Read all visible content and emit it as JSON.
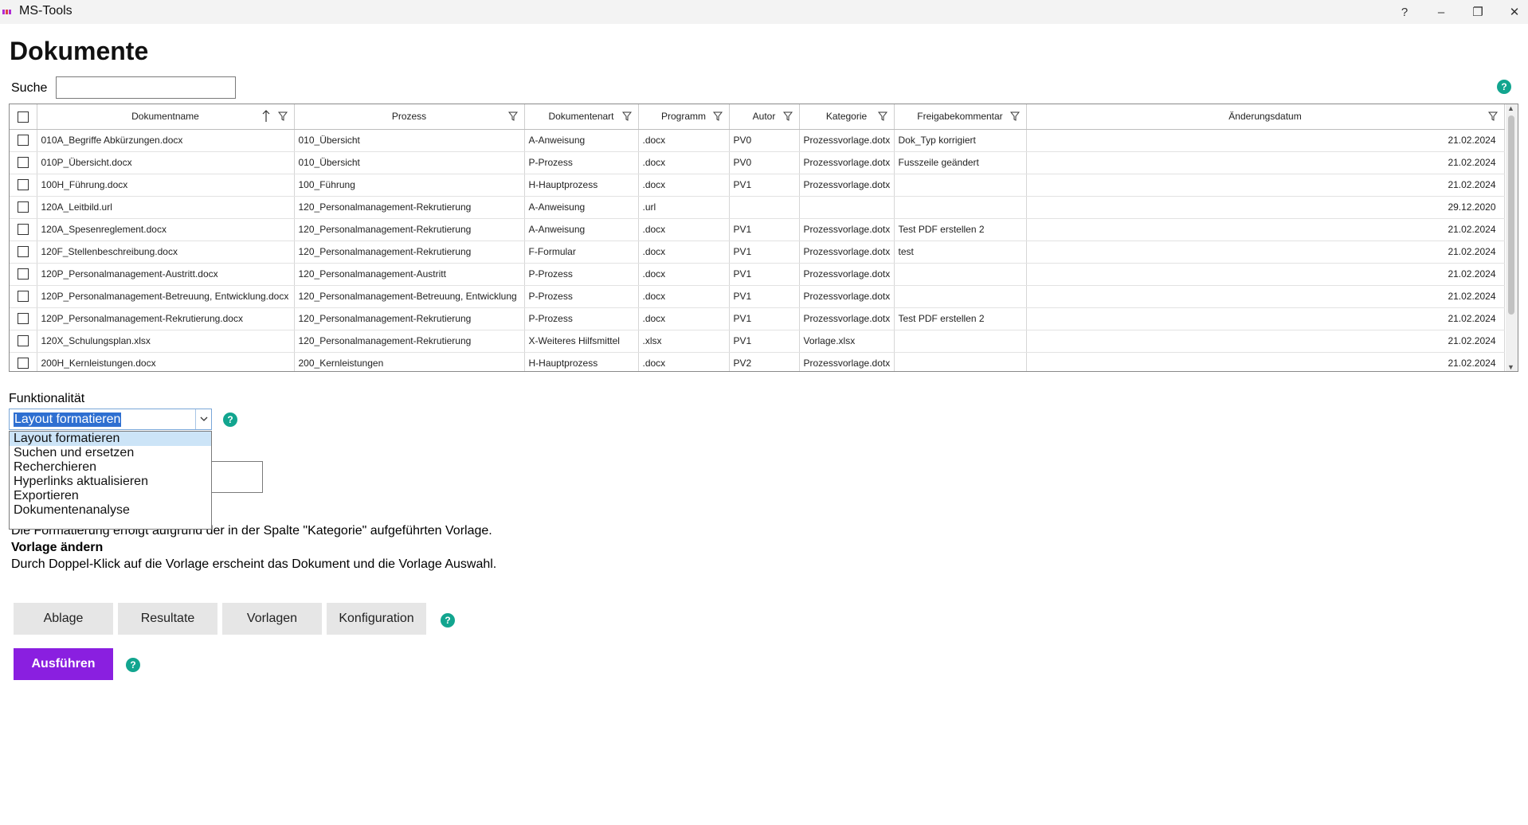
{
  "app": {
    "title": "MS-Tools",
    "help_glyph": "?"
  },
  "window_buttons": {
    "help": "?",
    "minimize": "–",
    "restore": "❐",
    "close": "✕"
  },
  "page_title": "Dokumente",
  "search": {
    "label": "Suche",
    "value": ""
  },
  "help_glyph": "?",
  "table": {
    "columns": [
      "",
      "Dokumentname",
      "Prozess",
      "Dokumentenart",
      "Programm",
      "Autor",
      "Kategorie",
      "Freigabekommentar",
      "Änderungsdatum"
    ],
    "rows": [
      [
        "010A_Begriffe Abkürzungen.docx",
        "010_Übersicht",
        "A-Anweisung",
        ".docx",
        "PV0",
        "Prozessvorlage.dotx",
        "Dok_Typ korrigiert",
        "21.02.2024"
      ],
      [
        "010P_Übersicht.docx",
        "010_Übersicht",
        "P-Prozess",
        ".docx",
        "PV0",
        "Prozessvorlage.dotx",
        "Fusszeile geändert",
        "21.02.2024"
      ],
      [
        "100H_Führung.docx",
        "100_Führung",
        "H-Hauptprozess",
        ".docx",
        "PV1",
        "Prozessvorlage.dotx",
        "",
        "21.02.2024"
      ],
      [
        "120A_Leitbild.url",
        "120_Personalmanagement-Rekrutierung",
        "A-Anweisung",
        ".url",
        "",
        "",
        "",
        "29.12.2020"
      ],
      [
        "120A_Spesenreglement.docx",
        "120_Personalmanagement-Rekrutierung",
        "A-Anweisung",
        ".docx",
        "PV1",
        "Prozessvorlage.dotx",
        "Test PDF erstellen 2",
        "21.02.2024"
      ],
      [
        "120F_Stellenbeschreibung.docx",
        "120_Personalmanagement-Rekrutierung",
        "F-Formular",
        ".docx",
        "PV1",
        "Prozessvorlage.dotx",
        "test",
        "21.02.2024"
      ],
      [
        "120P_Personalmanagement-Austritt.docx",
        "120_Personalmanagement-Austritt",
        "P-Prozess",
        ".docx",
        "PV1",
        "Prozessvorlage.dotx",
        "",
        "21.02.2024"
      ],
      [
        "120P_Personalmanagement-Betreuung, Entwicklung.docx",
        "120_Personalmanagement-Betreuung, Entwicklung",
        "P-Prozess",
        ".docx",
        "PV1",
        "Prozessvorlage.dotx",
        "",
        "21.02.2024"
      ],
      [
        "120P_Personalmanagement-Rekrutierung.docx",
        "120_Personalmanagement-Rekrutierung",
        "P-Prozess",
        ".docx",
        "PV1",
        "Prozessvorlage.dotx",
        "Test PDF erstellen 2",
        "21.02.2024"
      ],
      [
        "120X_Schulungsplan.xlsx",
        "120_Personalmanagement-Rekrutierung",
        "X-Weiteres Hilfsmittel",
        ".xlsx",
        "PV1",
        "Vorlage.xlsx",
        "",
        "21.02.2024"
      ],
      [
        "200H_Kernleistungen.docx",
        "200_Kernleistungen",
        "H-Hauptprozess",
        ".docx",
        "PV2",
        "Prozessvorlage.dotx",
        "",
        "21.02.2024"
      ]
    ]
  },
  "functionality": {
    "label": "Funktionalität",
    "selected": "Layout formatieren",
    "options": [
      "Layout formatieren",
      "Suchen und ersetzen",
      "Recherchieren",
      "Hyperlinks aktualisieren",
      "Exportieren",
      "Dokumentenanalyse"
    ]
  },
  "description": {
    "line1": "Die Formatierung erfolgt aufgrund der in der Spalte \"Kategorie\" aufgeführten Vorlage.",
    "heading": "Vorlage ändern",
    "line2": "Durch Doppel-Klick auf die Vorlage erscheint das Dokument und die Vorlage Auswahl."
  },
  "tabs": [
    "Ablage",
    "Resultate",
    "Vorlagen",
    "Konfiguration"
  ],
  "run_button": "Ausführen",
  "colors": {
    "accent": "#8a1fe0",
    "help": "#12a58f",
    "selection": "#2e6fd1"
  }
}
